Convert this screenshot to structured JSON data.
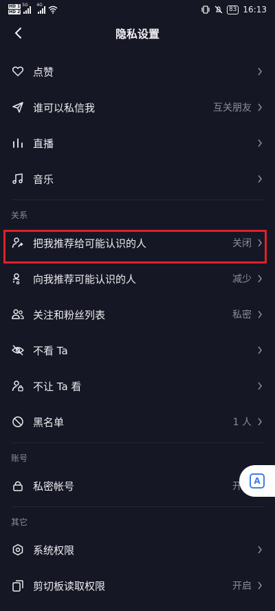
{
  "status_bar": {
    "hd1": "HD 1",
    "hd2": "HD 2",
    "sig1": "5G",
    "sig2": "4G",
    "battery": "83",
    "time": "16:13"
  },
  "header": {
    "title": "隐私设置"
  },
  "rows_top": [
    {
      "label": "点赞",
      "value": ""
    },
    {
      "label": "谁可以私信我",
      "value": "互关朋友"
    },
    {
      "label": "直播",
      "value": ""
    },
    {
      "label": "音乐",
      "value": ""
    }
  ],
  "section_relations": "关系",
  "rows_relations": [
    {
      "label": "把我推荐给可能认识的人",
      "value": "关闭"
    },
    {
      "label": "向我推荐可能认识的人",
      "value": "减少"
    },
    {
      "label": "关注和粉丝列表",
      "value": "私密"
    },
    {
      "label": "不看 Ta",
      "value": ""
    },
    {
      "label": "不让 Ta 看",
      "value": ""
    },
    {
      "label": "黑名单",
      "value": "1 人"
    }
  ],
  "section_account": "账号",
  "rows_account": [
    {
      "label": "私密帐号",
      "value": "开启"
    }
  ],
  "section_other": "其它",
  "rows_other": [
    {
      "label": "系统权限",
      "value": ""
    },
    {
      "label": "剪切板读取权限",
      "value": "开启"
    }
  ],
  "float_button": {
    "label": "A"
  },
  "colors": {
    "background": "#161724",
    "highlight": "#e0202a",
    "accent": "#3f7be8"
  }
}
